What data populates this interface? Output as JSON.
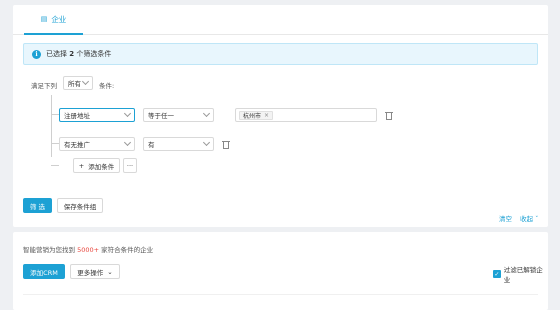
{
  "tabs": [
    {
      "label": "企业",
      "icon": "building-icon"
    }
  ],
  "alert": {
    "prefix": "已选择",
    "count": "2",
    "suffix": "个筛选条件"
  },
  "filter": {
    "match_label": "满足下列",
    "match_value": "所有",
    "conditions_label": "条件:",
    "rows": [
      {
        "field": "注册地址",
        "operator": "等于任一",
        "tags": [
          "杭州市"
        ]
      },
      {
        "field": "有无推广",
        "operator": "有"
      }
    ],
    "add_condition_label": "添加条件",
    "more_label": "···"
  },
  "actions": {
    "filter_label": "筛 选",
    "save_group_label": "保存条件组",
    "clear_label": "清空",
    "collapse_label": "收起"
  },
  "results": {
    "title_prefix": "智能营销为您找到",
    "count": "5000+",
    "title_suffix": "家符合条件的企业",
    "add_crm_label": "添加CRM",
    "more_actions_label": "更多操作",
    "filter_unlocked_label": "过滤已解锁企业",
    "filter_unlocked_checked": true
  },
  "colors": {
    "accent": "#1da1d4",
    "highlight": "#e8453c"
  }
}
